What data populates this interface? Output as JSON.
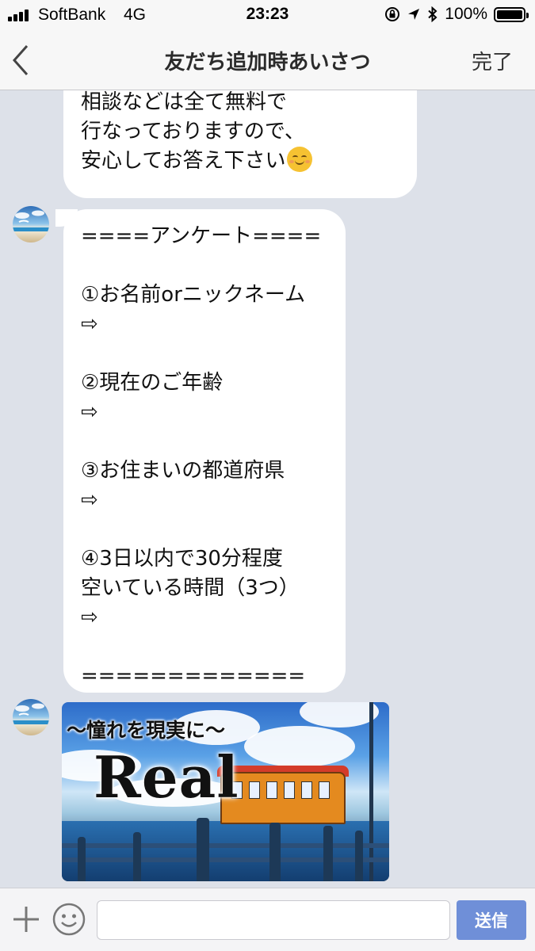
{
  "status_bar": {
    "carrier": "SoftBank",
    "network": "4G",
    "time": "23:23",
    "battery_percent": "100%",
    "battery_level": 1.0
  },
  "nav": {
    "title": "友だち追加時あいさつ",
    "done_label": "完了"
  },
  "messages": [
    {
      "lines": [
        "相談などは全て無料で",
        "行なっておりますので、",
        "安心してお答え下さい"
      ],
      "trailing_emoji": "relieved-smile-emoji"
    },
    {
      "lines": [
        "====アンケート====",
        "",
        "①お名前orニックネーム",
        "⇨",
        "",
        "②現在のご年齢",
        "⇨",
        "",
        "③お住まいの都道府県",
        "⇨",
        "",
        "④3日以内で30分程度",
        "空いている時間（3つ）",
        "⇨",
        "",
        "============="
      ]
    },
    {
      "image": {
        "tagline": "〜憧れを現実に〜",
        "title": "Real"
      }
    }
  ],
  "input_bar": {
    "message_value": "",
    "send_label": "送信"
  },
  "colors": {
    "chat_background": "#dde1e9",
    "bubble": "#ffffff",
    "send_button": "#6f8fd8"
  }
}
